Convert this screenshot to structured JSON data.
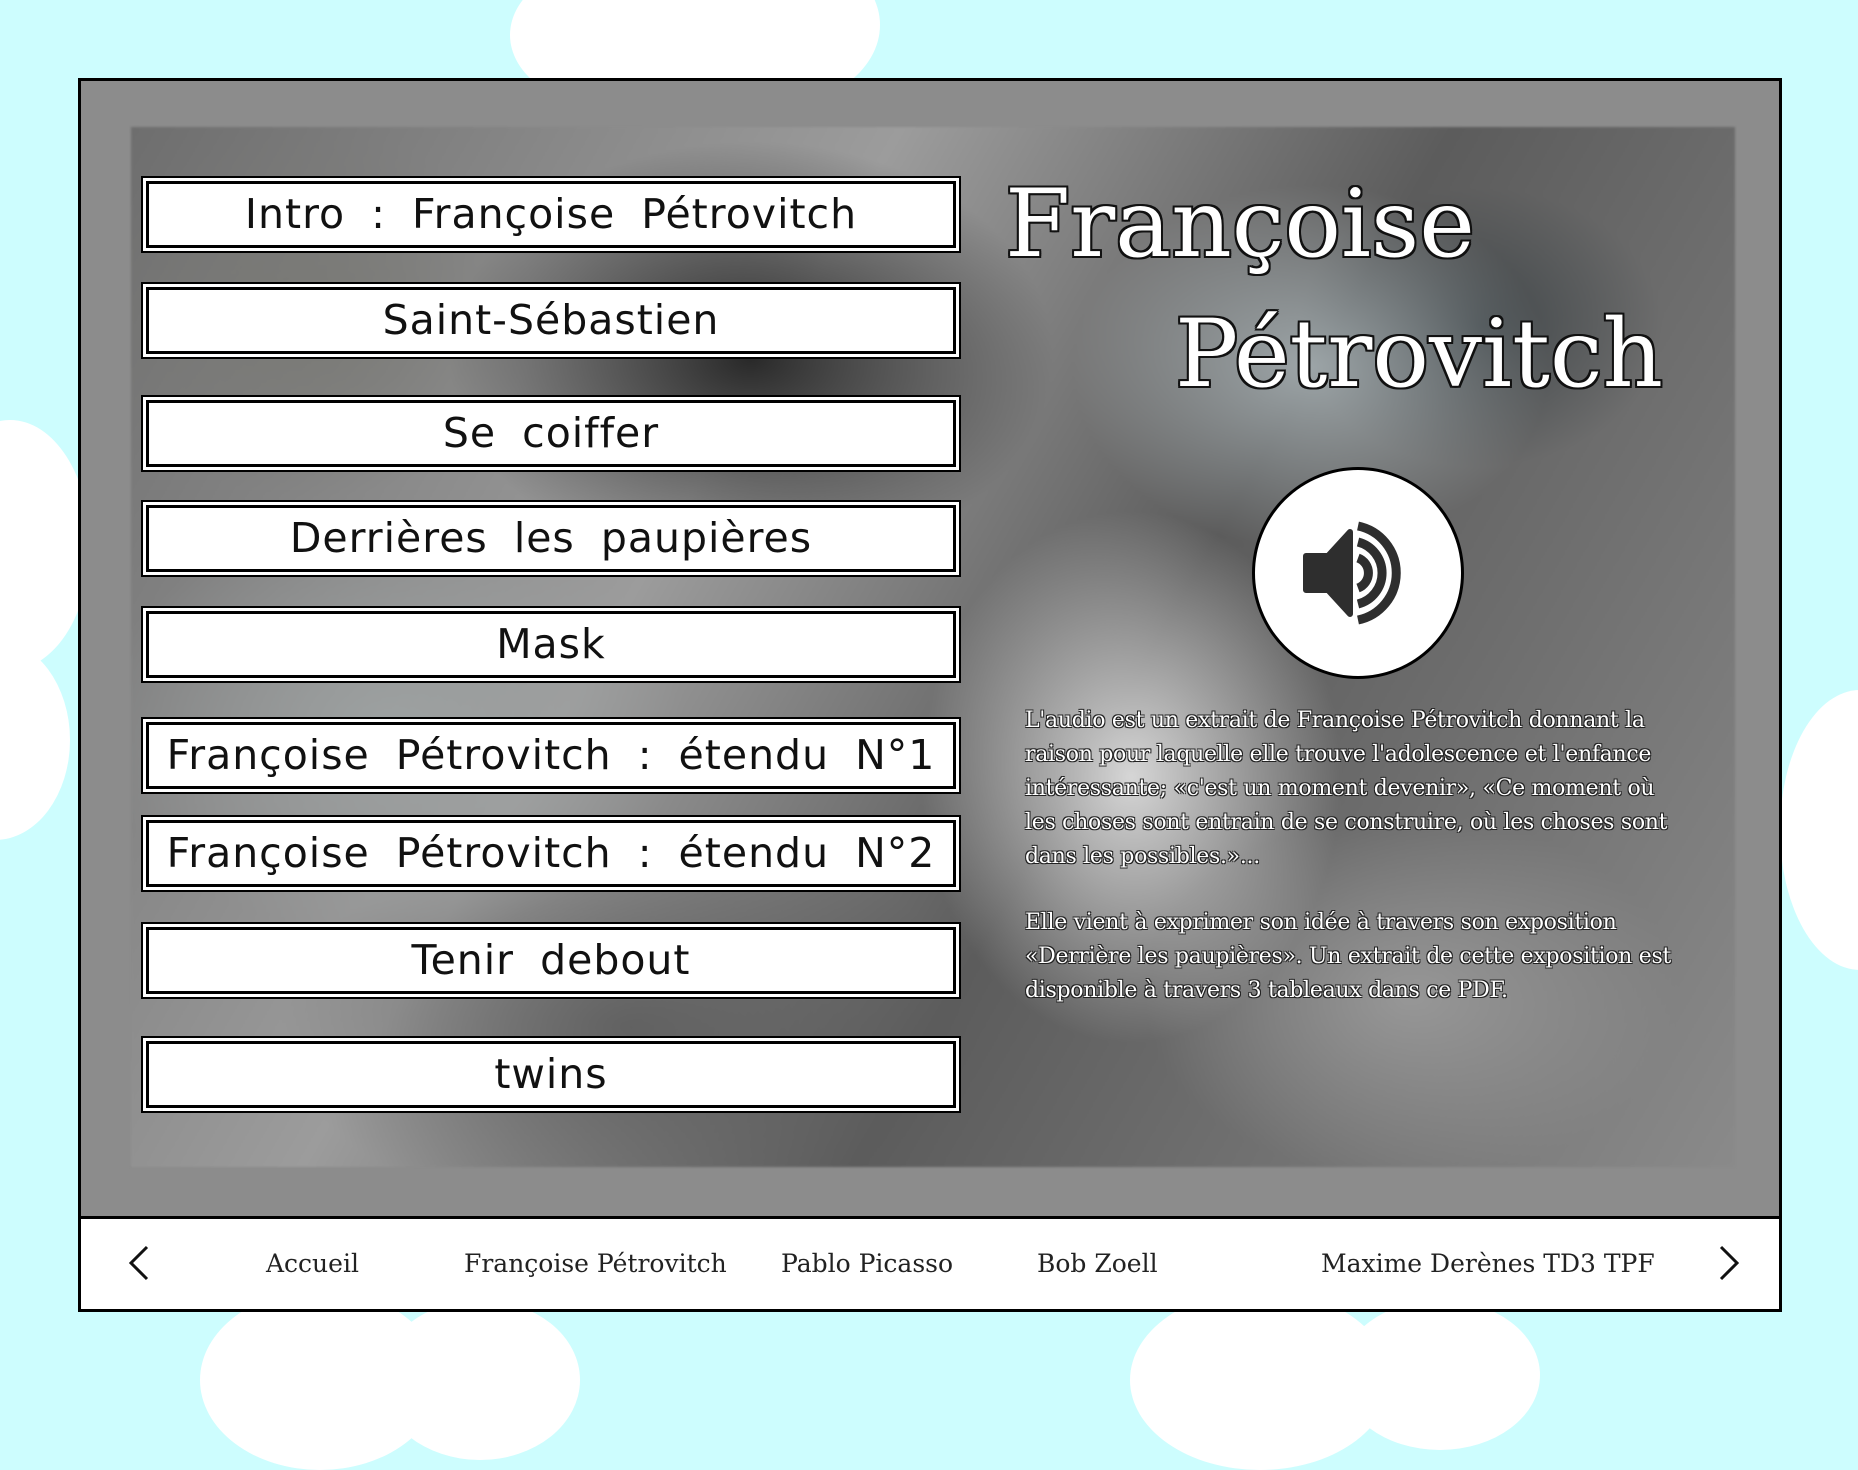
{
  "menu": {
    "items": [
      {
        "label": "Intro : Françoise Pétrovitch"
      },
      {
        "label": "Saint-Sébastien"
      },
      {
        "label": "Se coiffer"
      },
      {
        "label": "Derrières les paupières"
      },
      {
        "label": "Mask"
      },
      {
        "label": "Françoise Pétrovitch : étendu N°1"
      },
      {
        "label": "Françoise Pétrovitch : étendu N°2"
      },
      {
        "label": "Tenir debout"
      },
      {
        "label": "twins"
      }
    ]
  },
  "title": {
    "line1": "Françoise",
    "line2": "Pétrovitch"
  },
  "audio": {
    "icon": "speaker-icon"
  },
  "description": {
    "paragraph1": "L'audio est un extrait de Françoise Pétrovitch donnant la raison pour laquelle elle trouve l'adolescence et l'enfance intéressante; «c'est un moment devenir», «Ce moment où les choses sont entrain de se construire, où les choses sont dans les possibles.»...",
    "paragraph2": "Elle vient à exprimer son idée à travers son exposition «Derrière les paupières». Un extrait de cette exposition est disponible à travers 3 tableaux dans ce PDF."
  },
  "nav": {
    "prev_icon": "chevron-left-icon",
    "next_icon": "chevron-right-icon",
    "items": [
      {
        "label": "Accueil"
      },
      {
        "label": "Françoise Pétrovitch"
      },
      {
        "label": "Pablo Picasso"
      },
      {
        "label": "Bob Zoell"
      },
      {
        "label": "Maxime Derènes TD3 TPF"
      }
    ]
  },
  "colors": {
    "background": "#cdfdfe",
    "frame": "#8c8c8c",
    "button_bg": "#ffffff",
    "border": "#000000"
  }
}
